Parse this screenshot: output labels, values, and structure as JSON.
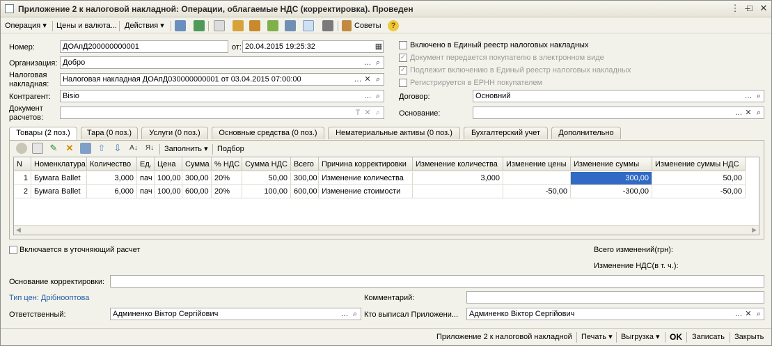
{
  "window": {
    "title": "Приложение 2 к налоговой накладной: Операции, облагаемые НДС (корректировка). Проведен"
  },
  "toolbar": {
    "operation": "Операция",
    "prices": "Цены и валюта...",
    "actions": "Действия",
    "tips": "Советы"
  },
  "header": {
    "number_label": "Номер:",
    "number_value": "ДОАпД200000000001",
    "date_label": "от:",
    "date_value": "20.04.2015 19:25:32",
    "org_label": "Организация:",
    "org_value": "Добро",
    "invoice_label_1": "Налоговая",
    "invoice_label_2": "накладная:",
    "invoice_value": "Налоговая накладная ДОАпД030000000001 от 03.04.2015 07:00:00",
    "contractor_label": "Контрагент:",
    "contractor_value": "Bisio",
    "settle_label_1": "Документ",
    "settle_label_2": "расчетов:",
    "contract_label": "Договор:",
    "contract_value": "Основний",
    "basis_label": "Основание:"
  },
  "checks": {
    "registry": "Включено в Единый реестр налоговых накладных",
    "electronic": "Документ передается покупателю в электронном виде",
    "include": "Подлежит включению в Единый реестр налоговых накладных",
    "erpn": "Регистрируется в ЕРНН покупателем"
  },
  "tabs": [
    "Товары (2 поз.)",
    "Тара (0 поз.)",
    "Услуги (0 поз.)",
    "Основные средства (0 поз.)",
    "Нематериальные активы (0 поз.)",
    "Бухгалтерский учет",
    "Дополнительно"
  ],
  "table_toolbar": {
    "fill": "Заполнить",
    "pick": "Подбор"
  },
  "table": {
    "columns": [
      "N",
      "Номенклатура",
      "Количество",
      "Ед.",
      "Цена",
      "Сумма",
      "% НДС",
      "Сумма НДС",
      "Всего",
      "Причина корректировки",
      "Изменение количества",
      "Изменение цены",
      "Изменение суммы",
      "Изменение суммы НДС"
    ],
    "rows": [
      [
        "1",
        "Бумага Ballet",
        "3,000",
        "пач",
        "100,00",
        "300,00",
        "20%",
        "50,00",
        "300,00",
        "Изменение количества",
        "3,000",
        "",
        "300,00",
        "50,00"
      ],
      [
        "2",
        "Бумага Ballet",
        "6,000",
        "пач",
        "100,00",
        "600,00",
        "20%",
        "100,00",
        "600,00",
        "Изменение стоимости",
        "",
        "-50,00",
        "-300,00",
        "-50,00"
      ]
    ]
  },
  "footer": {
    "refine": "Включается в уточняющий расчет",
    "total_changes": "Всего изменений(грн):",
    "vat_change": "Изменение НДС(в т. ч.):",
    "basis_label": "Основание корректировки:",
    "price_type": "Тип цен: Дрібнооптова",
    "comment_label": "Комментарий:",
    "responsible_label": "Ответственный:",
    "responsible_value": "Админенко Віктор Сергійович",
    "issued_label": "Кто выписал  Приложени...",
    "issued_value": "Админенко Віктор Сергійович"
  },
  "bottom": {
    "print_form": "Приложение 2 к налоговой накладной",
    "print": "Печать",
    "upload": "Выгрузка",
    "ok": "OK",
    "save": "Записать",
    "close": "Закрыть"
  },
  "colors": {
    "accent": "#316ac5",
    "link": "#1f5fa8",
    "window_bg": "#f3f2ea"
  }
}
